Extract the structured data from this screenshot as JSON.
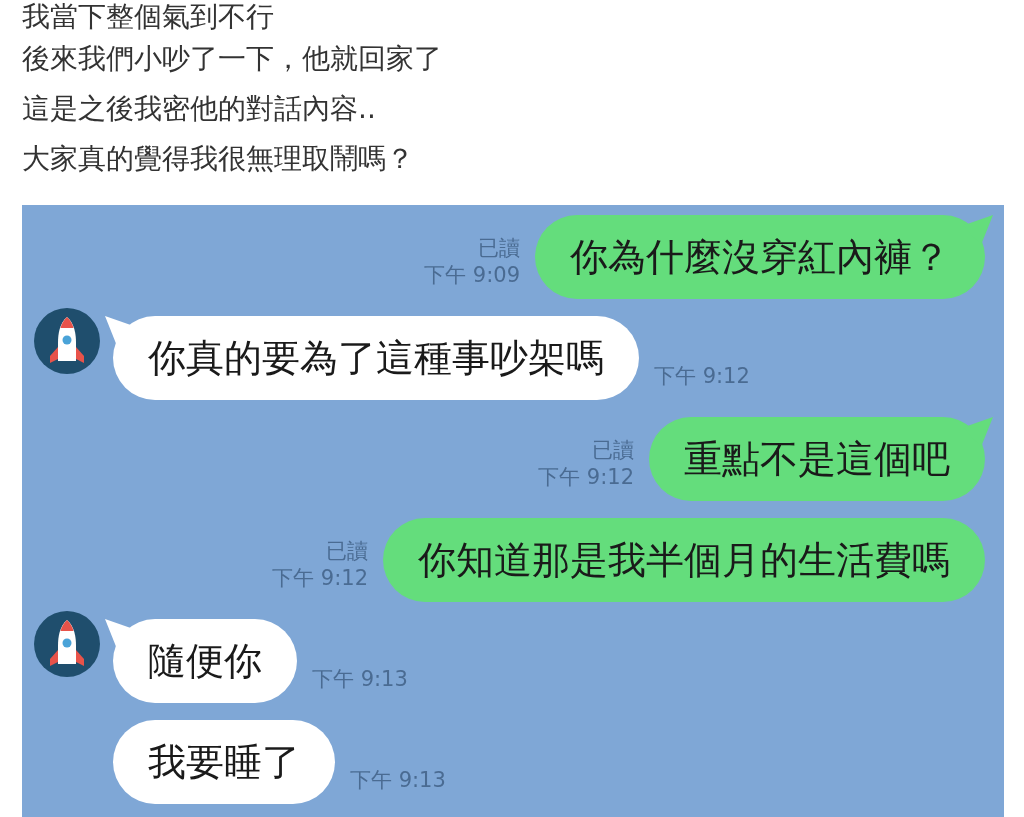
{
  "post": {
    "lines": [
      "我當下整個氣到不行",
      "後來我們小吵了一下，他就回家了",
      "這是之後我密他的對話內容..",
      "大家真的覺得我很無理取鬧嗎？"
    ]
  },
  "chat": {
    "messages": [
      {
        "kind": "sent",
        "text": "你為什麼沒穿紅內褲？",
        "read": "已讀",
        "time": "下午 9:09",
        "tail": true
      },
      {
        "kind": "received",
        "avatar": true,
        "text": "你真的要為了這種事吵架嗎",
        "time": "下午 9:12",
        "tail": true
      },
      {
        "kind": "sent",
        "text": "重點不是這個吧",
        "read": "已讀",
        "time": "下午 9:12",
        "tail": true
      },
      {
        "kind": "sent",
        "text": "你知道那是我半個月的生活費嗎",
        "read": "已讀",
        "time": "下午 9:12",
        "tail": false
      },
      {
        "kind": "received",
        "avatar": true,
        "text": "隨便你",
        "time": "下午 9:13",
        "tail": true
      },
      {
        "kind": "received",
        "avatar": false,
        "text": "我要睡了",
        "time": "下午 9:13",
        "tail": false
      }
    ]
  }
}
